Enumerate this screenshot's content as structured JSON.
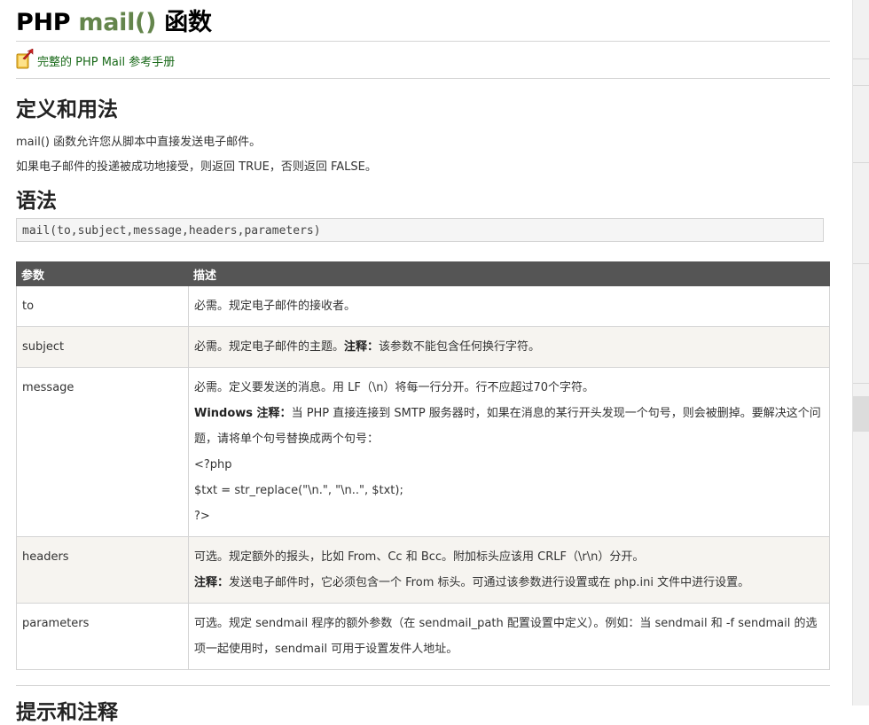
{
  "title": {
    "prefix": "PHP",
    "fn": "mail()",
    "suffix": "函数"
  },
  "reference_link": {
    "text": "完整的 PHP Mail 参考手册",
    "icon": "book-arrow-icon"
  },
  "definition": {
    "heading": "定义和用法",
    "lines": [
      "mail() 函数允许您从脚本中直接发送电子邮件。",
      "如果电子邮件的投递被成功地接受，则返回 TRUE，否则返回 FALSE。"
    ]
  },
  "syntax": {
    "heading": "语法",
    "code": "mail(to,subject,message,headers,parameters)"
  },
  "params_table": {
    "headers": [
      "参数",
      "描述"
    ],
    "rows": [
      {
        "name": "to",
        "lines": [
          {
            "text": "必需。规定电子邮件的接收者。"
          }
        ]
      },
      {
        "name": "subject",
        "lines": [
          {
            "text": "必需。规定电子邮件的主题。",
            "note": "注释：",
            "after": "该参数不能包含任何换行字符。"
          }
        ]
      },
      {
        "name": "message",
        "lines": [
          {
            "text": "必需。定义要发送的消息。用 LF（\\n）将每一行分开。行不应超过70个字符。"
          },
          {
            "note": "Windows 注释：",
            "after": "当 PHP 直接连接到 SMTP 服务器时，如果在消息的某行开头发现一个句号，则会被删掉。要解决这个问题，请将单个句号替换成两个句号："
          },
          {
            "text": "<?php"
          },
          {
            "text": "$txt = str_replace(\"\\n.\", \"\\n..\", $txt);"
          },
          {
            "text": "?>"
          }
        ]
      },
      {
        "name": "headers",
        "lines": [
          {
            "text": "可选。规定额外的报头，比如 From、Cc 和 Bcc。附加标头应该用 CRLF（\\r\\n）分开。"
          },
          {
            "note": "注释：",
            "after": "发送电子邮件时，它必须包含一个 From 标头。可通过该参数进行设置或在 php.ini 文件中进行设置。"
          }
        ]
      },
      {
        "name": "parameters",
        "lines": [
          {
            "text": "可选。规定 sendmail 程序的额外参数（在 sendmail_path 配置设置中定义）。例如：当 sendmail 和 -f sendmail 的选项一起使用时，sendmail 可用于设置发件人地址。"
          }
        ]
      }
    ]
  },
  "next_heading": "提示和注释",
  "colors": {
    "accent": "#64854c",
    "table_header": "#555555",
    "row_alt": "#f6f4f0",
    "link": "#1a6a1a"
  }
}
